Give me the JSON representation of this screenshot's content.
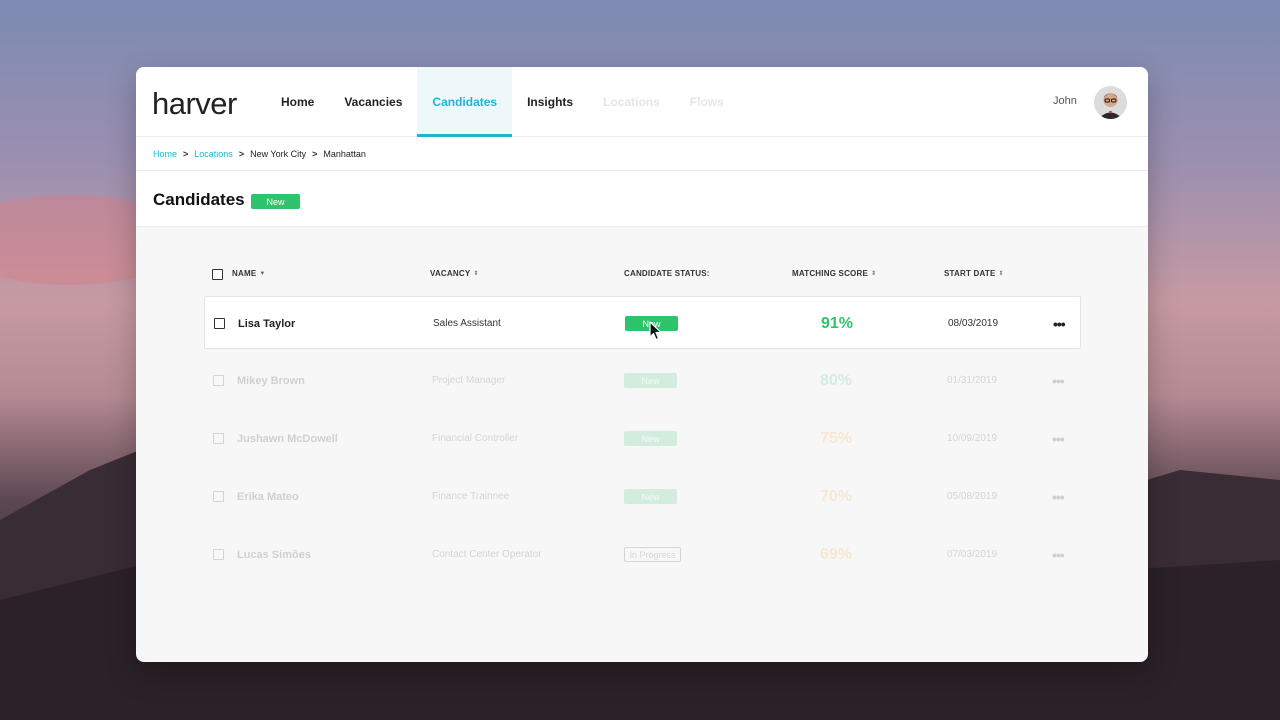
{
  "app": {
    "logo": "harver",
    "user_name": "John"
  },
  "nav": {
    "items": [
      {
        "label": "Home",
        "state": "normal"
      },
      {
        "label": "Vacancies",
        "state": "normal"
      },
      {
        "label": "Candidates",
        "state": "active"
      },
      {
        "label": "Insights",
        "state": "normal"
      },
      {
        "label": "Locations",
        "state": "faded"
      },
      {
        "label": "Flows",
        "state": "faded"
      }
    ]
  },
  "breadcrumb": [
    "Home",
    "Locations",
    "New York City",
    "Manhattan"
  ],
  "breadcrumb_separator": ">",
  "page": {
    "title": "Candidates",
    "badge": "New"
  },
  "table": {
    "headers": {
      "name": "NAME",
      "vacancy": "VACANCY",
      "status": "CANDIDATE STATUS:",
      "score": "MATCHING SCORE",
      "start_date": "START DATE"
    },
    "rows": [
      {
        "name": "Lisa Taylor",
        "vacancy": "Sales Assistant",
        "status": "New",
        "score": "91%",
        "start_date": "08/03/2019",
        "more": "•••"
      },
      {
        "name": "Mikey Brown",
        "vacancy": "Project Manager",
        "status": "New",
        "score": "80%",
        "start_date": "01/31/2019",
        "more": "•••"
      },
      {
        "name": "Jushawn McDowell",
        "vacancy": "Financial Controller",
        "status": "New",
        "score": "75%",
        "start_date": "10/09/2019",
        "more": "•••"
      },
      {
        "name": "Erika Mateo",
        "vacancy": "Finance Trainnee",
        "status": "New",
        "score": "70%",
        "start_date": "05/08/2019",
        "more": "•••"
      },
      {
        "name": "Lucas Simões",
        "vacancy": "Contact Center Operator",
        "status": "In Progress",
        "score": "69%",
        "start_date": "07/03/2019",
        "more": "•••"
      }
    ]
  },
  "colors": {
    "accent": "#1fb6d6",
    "status_new": "#2ec46c",
    "score_high": "#2ec46c",
    "score_medium": "#f0a030"
  }
}
